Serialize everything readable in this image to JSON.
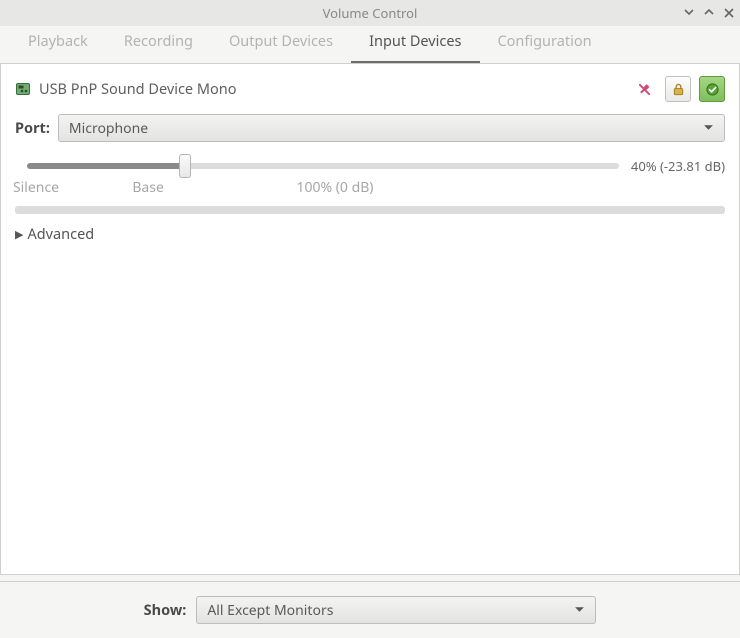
{
  "window": {
    "title": "Volume Control"
  },
  "tabs": {
    "playback": "Playback",
    "recording": "Recording",
    "output_devices": "Output Devices",
    "input_devices": "Input Devices",
    "configuration": "Configuration",
    "active": "input_devices"
  },
  "device": {
    "name": "USB PnP Sound Device Mono",
    "port_label": "Port:",
    "port_value": "Microphone",
    "volume_percent": 40,
    "volume_db": -23.81,
    "volume_readout": "40% (-23.81 dB)",
    "scale": {
      "silence": "Silence",
      "base": "Base",
      "hundred": "100% (0 dB)",
      "base_pos_pct": 26.5,
      "hundred_pos_pct": 66.5,
      "max_pct": 150
    },
    "advanced_label": "Advanced"
  },
  "footer": {
    "show_label": "Show:",
    "show_value": "All Except Monitors"
  },
  "icons": {
    "mic_pin": "mic-pin-icon",
    "lock": "lock-icon",
    "fallback_check": "fallback-check-icon",
    "sound_card": "sound-card-icon"
  }
}
